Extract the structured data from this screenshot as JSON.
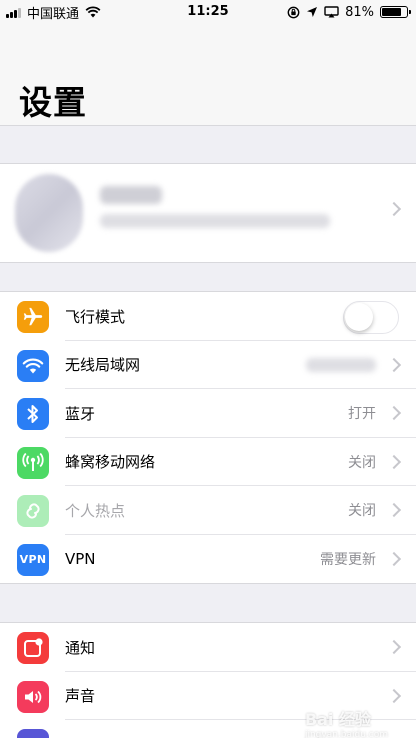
{
  "status_bar": {
    "carrier": "中国联通",
    "time": "11:25",
    "battery": "81%",
    "battery_level": 0.81,
    "icons": [
      "signal-icon",
      "wifi-icon",
      "orientation-lock-icon",
      "location-icon",
      "airplay-icon",
      "battery-icon"
    ]
  },
  "header": {
    "title": "设置"
  },
  "colors": {
    "airplane": "#f59e0b",
    "wifi": "#2a7ef5",
    "bluetooth": "#2a7ef5",
    "cellular": "#4cd964",
    "hotspot": "#4cd964",
    "vpn": "#2a7ef5",
    "notifications": "#f43b3b",
    "sounds": "#f43b5c",
    "screen_time": "#5856d6"
  },
  "group1": {
    "items": [
      {
        "label": "飞行模式",
        "value": "",
        "icon": "airplane-icon"
      },
      {
        "label": "无线局域网",
        "value": "",
        "icon": "wifi-icon"
      },
      {
        "label": "蓝牙",
        "value": "打开",
        "icon": "bluetooth-icon"
      },
      {
        "label": "蜂窝移动网络",
        "value": "关闭",
        "icon": "cellular-icon"
      },
      {
        "label": "个人热点",
        "value": "关闭",
        "icon": "hotspot-icon"
      },
      {
        "label": "VPN",
        "value": "需要更新",
        "icon": "vpn-icon",
        "icon_text": "VPN"
      }
    ]
  },
  "group2": {
    "items": [
      {
        "label": "通知",
        "icon": "notifications-icon"
      },
      {
        "label": "声音",
        "icon": "sounds-icon"
      }
    ]
  },
  "watermark": {
    "brand": "Bai 经验",
    "url": "jingyan.baidu.com"
  }
}
